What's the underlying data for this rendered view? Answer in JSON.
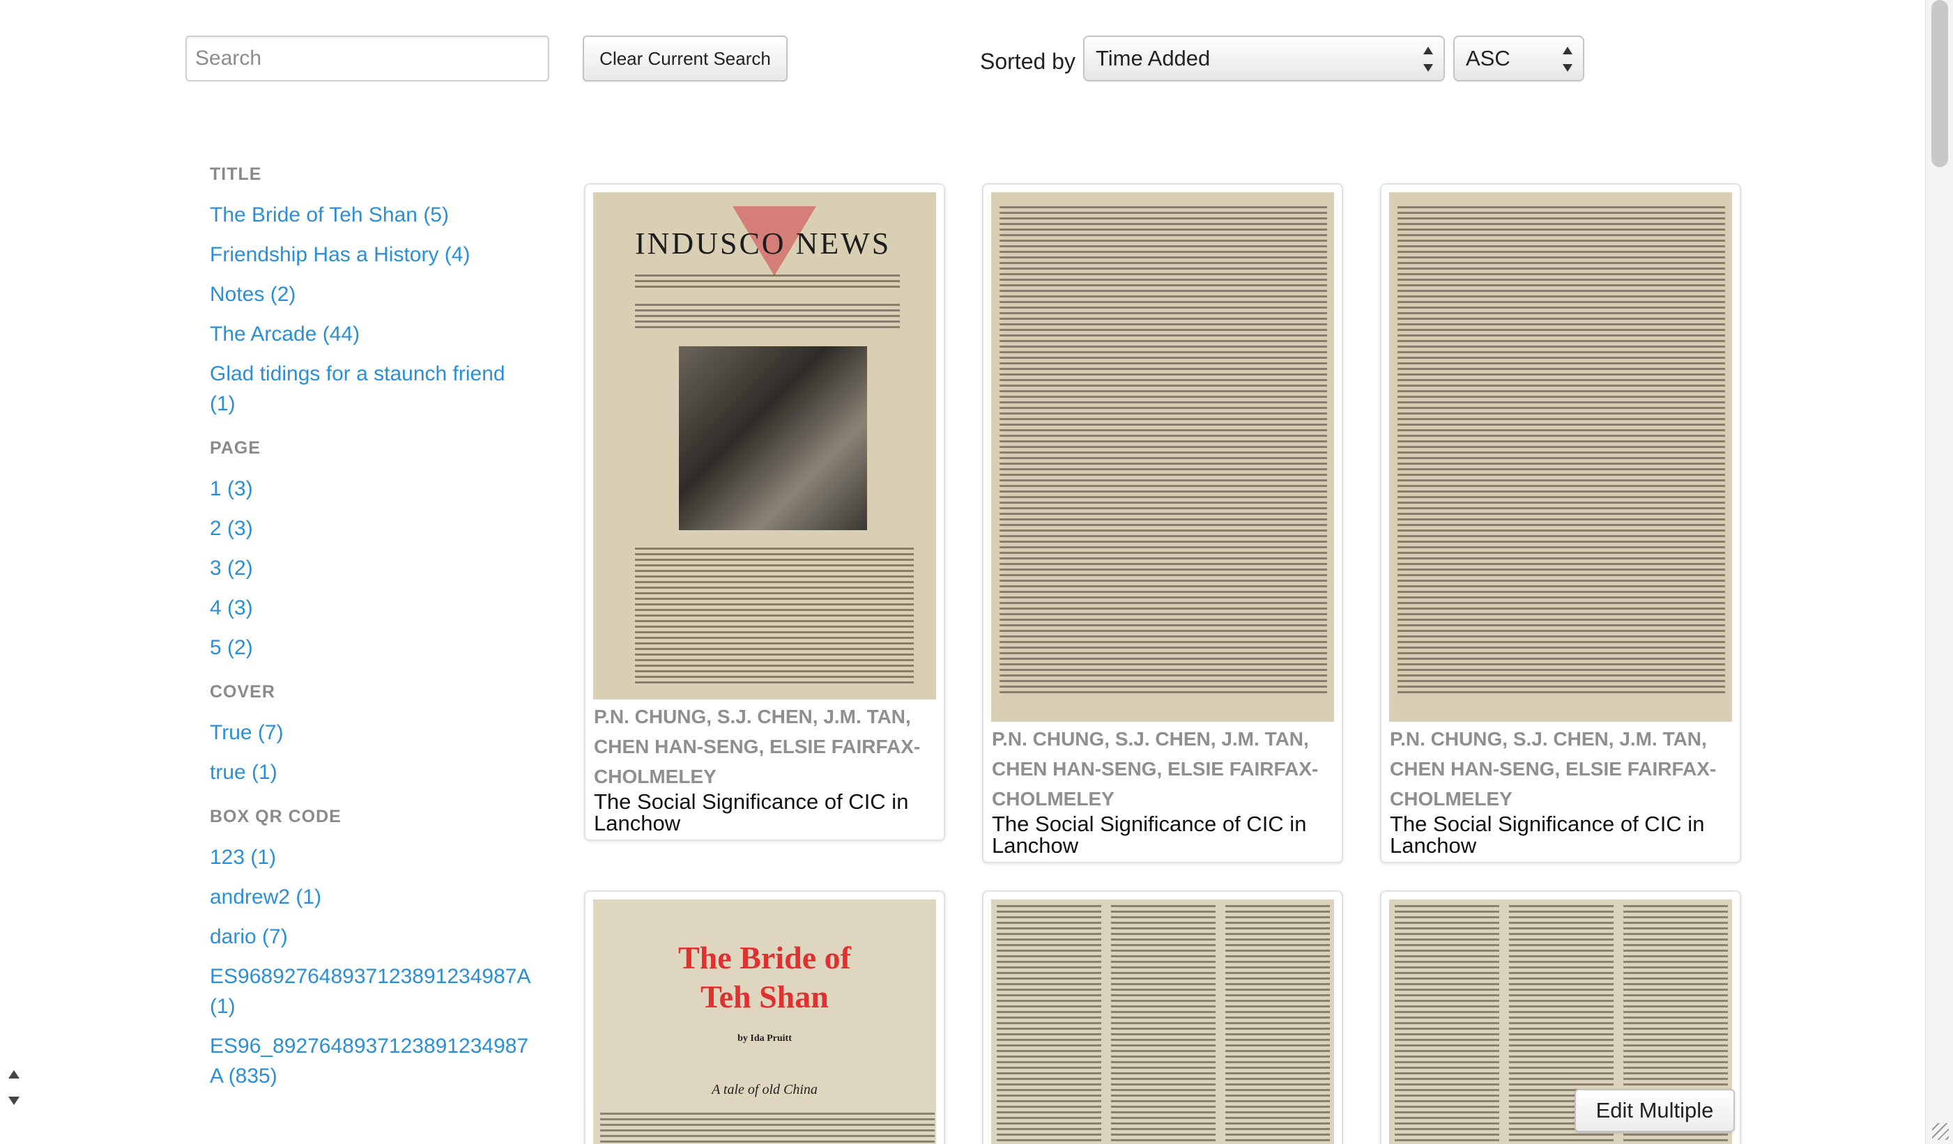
{
  "toolbar": {
    "search_placeholder": "Search",
    "clear_label": "Clear Current Search",
    "sorted_by_label": "Sorted by",
    "sort_field": "Time Added",
    "sort_order": "ASC"
  },
  "facets": [
    {
      "heading": "TITLE",
      "items": [
        "The Bride of Teh Shan (5)",
        "Friendship Has a History (4)",
        "Notes (2)",
        "The Arcade (44)",
        "Glad tidings for a staunch friend (1)"
      ]
    },
    {
      "heading": "PAGE",
      "items": [
        "1 (3)",
        "2 (3)",
        "3 (2)",
        "4 (3)",
        "5 (2)"
      ]
    },
    {
      "heading": "COVER",
      "items": [
        "True (7)",
        "true (1)"
      ]
    },
    {
      "heading": "BOX QR CODE",
      "items": [
        "123 (1)",
        "andrew2 (1)",
        "dario (7)",
        "ES9689276489371238912349​87A (1)",
        "ES96_8927648937123891234987A (835)"
      ]
    }
  ],
  "cards": [
    {
      "authors": "P.N. CHUNG, S.J. CHEN, J.M. TAN, CHEN HAN-SENG, ELSIE FAIRFAX-CHOLMELEY",
      "title": "The Social Significance of CIC in Lanchow",
      "thumb": {
        "masthead": "INDUSCO NEWS"
      }
    },
    {
      "authors": "P.N. CHUNG, S.J. CHEN, J.M. TAN, CHEN HAN-SENG, ELSIE FAIRFAX-CHOLMELEY",
      "title": "The Social Significance of CIC in Lanchow"
    },
    {
      "authors": "P.N. CHUNG, S.J. CHEN, J.M. TAN, CHEN HAN-SENG, ELSIE FAIRFAX-CHOLMELEY",
      "title": "The Social Significance of CIC in Lanchow"
    }
  ],
  "bride_cover": {
    "title": "The Bride of Teh Shan",
    "by": "by Ida Pruitt",
    "subtitle": "A tale of old China"
  },
  "edit_multiple_label": "Edit Multiple",
  "colors": {
    "link": "#2a8fd6",
    "facet_heading": "#8a8a8a",
    "paper": "#d9cfb4",
    "bride_title": "#e03030"
  }
}
